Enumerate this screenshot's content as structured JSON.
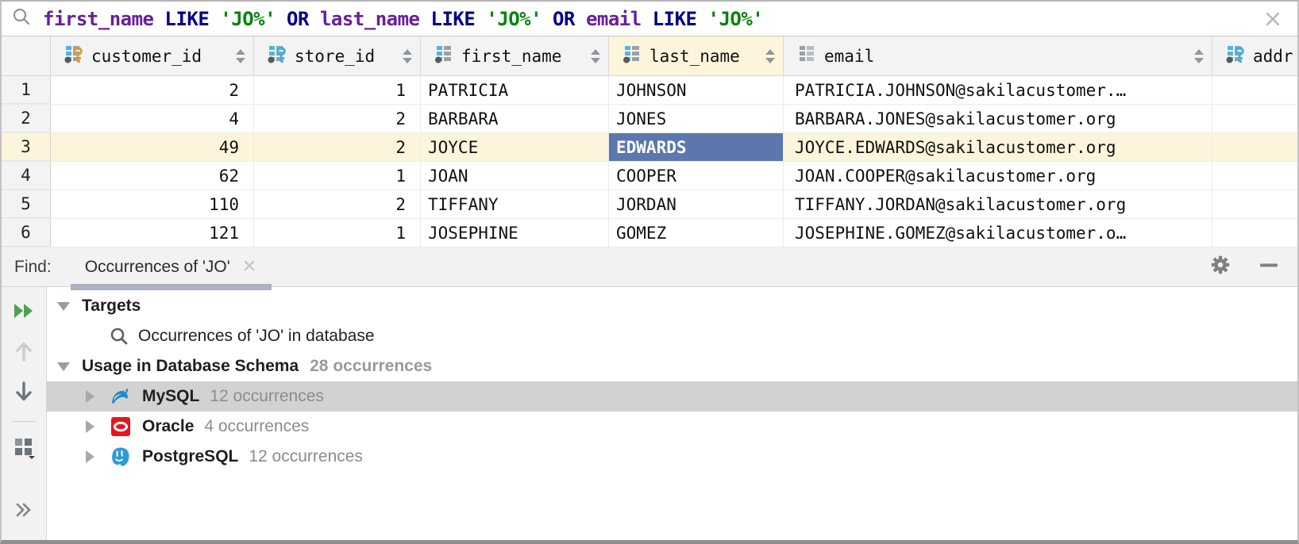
{
  "filter": {
    "parts": [
      {
        "text": "first_name",
        "type": "column"
      },
      {
        "text": "LIKE",
        "type": "keyword"
      },
      {
        "text": "'JO%'",
        "type": "string"
      },
      {
        "text": "OR",
        "type": "keyword"
      },
      {
        "text": "last_name",
        "type": "column"
      },
      {
        "text": "LIKE",
        "type": "keyword"
      },
      {
        "text": "'JO%'",
        "type": "string"
      },
      {
        "text": "OR",
        "type": "keyword"
      },
      {
        "text": "email",
        "type": "column"
      },
      {
        "text": "LIKE",
        "type": "keyword"
      },
      {
        "text": "'JO%'",
        "type": "string"
      }
    ],
    "icons": {
      "left": "search-icon",
      "right": "close-icon"
    }
  },
  "grid": {
    "columns": [
      {
        "label": "customer_id",
        "icon": "column-gold-key-icon",
        "sortable": true
      },
      {
        "label": "store_id",
        "icon": "column-blue-key-icon",
        "sortable": true
      },
      {
        "label": "first_name",
        "icon": "column-icon",
        "sortable": true
      },
      {
        "label": "last_name",
        "icon": "column-icon",
        "sortable": true,
        "selected": true
      },
      {
        "label": "email",
        "icon": "column-plain-icon",
        "sortable": true
      },
      {
        "label": "addr",
        "icon": "column-blue-key-icon"
      }
    ],
    "rows": [
      {
        "num": "1",
        "customer_id": "2",
        "store_id": "1",
        "first_name": "PATRICIA",
        "last_name": "JOHNSON",
        "email": "PATRICIA.JOHNSON@sakilacustomer.…"
      },
      {
        "num": "2",
        "customer_id": "4",
        "store_id": "2",
        "first_name": "BARBARA",
        "last_name": "JONES",
        "email": "BARBARA.JONES@sakilacustomer.org"
      },
      {
        "num": "3",
        "customer_id": "49",
        "store_id": "2",
        "first_name": "JOYCE",
        "last_name": "EDWARDS",
        "email": "JOYCE.EDWARDS@sakilacustomer.org",
        "highlighted": true,
        "selected_cell": "last_name"
      },
      {
        "num": "4",
        "customer_id": "62",
        "store_id": "1",
        "first_name": "JOAN",
        "last_name": "COOPER",
        "email": "JOAN.COOPER@sakilacustomer.org"
      },
      {
        "num": "5",
        "customer_id": "110",
        "store_id": "2",
        "first_name": "TIFFANY",
        "last_name": "JORDAN",
        "email": "TIFFANY.JORDAN@sakilacustomer.org"
      },
      {
        "num": "6",
        "customer_id": "121",
        "store_id": "1",
        "first_name": "JOSEPHINE",
        "last_name": "GOMEZ",
        "email": "JOSEPHINE.GOMEZ@sakilacustomer.o…"
      }
    ],
    "colors": {
      "selected_cell_bg": "#5b77ad",
      "highlighted_row_bg": "#fcf5dc",
      "header_bg": "#f3f3f3"
    }
  },
  "find": {
    "label": "Find:",
    "tab_title": "Occurrences of 'JO'",
    "tab_underline_color": "#a9b3c3",
    "actions": [
      "settings-gear-icon",
      "hide-minimize-icon"
    ],
    "toolbar": [
      "rerun-icon",
      "previous-occurrence-icon",
      "next-occurrence-icon",
      "group-by-icon",
      "expand-icon"
    ],
    "tree": {
      "targets": "Targets",
      "target_item": "Occurrences of 'JO' in database",
      "usage": "Usage in Database Schema",
      "usage_count": "28 occurrences",
      "groups": [
        {
          "name": "MySQL",
          "count": "12 occurrences",
          "icon": "mysql-icon",
          "selected": true
        },
        {
          "name": "Oracle",
          "count": "4 occurrences",
          "icon": "oracle-icon"
        },
        {
          "name": "PostgreSQL",
          "count": "12 occurrences",
          "icon": "postgresql-icon"
        }
      ]
    }
  }
}
